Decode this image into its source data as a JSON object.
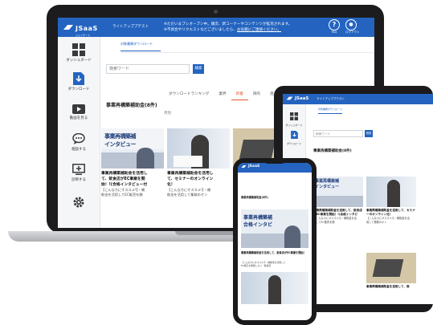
{
  "app": {
    "logo_text": "JSaaS",
    "logo_sub": "ジェイサース",
    "app_name": "ライトアッププテスト",
    "notice_line1": "※ただいまプレオープン中。順次、新コーナーやコンテンツが拡充されます。",
    "notice_line2_pre": "※不具合やリクエストなどございましたら、",
    "notice_line2_link": "お気軽にご連絡ください。",
    "faq_label": "FAQ",
    "logout_label": "ログアウト",
    "help_glyph": "?",
    "user_glyph": "●"
  },
  "sidebar": {
    "items": [
      {
        "label": "ダッシュボード",
        "icon": "grid-icon"
      },
      {
        "label": "ダウンロード",
        "icon": "download-icon"
      },
      {
        "label": "動画を見る",
        "icon": "video-icon"
      },
      {
        "label": "相談する",
        "icon": "chat-icon"
      },
      {
        "label": "診断する",
        "icon": "monitor-icon"
      },
      {
        "label": "",
        "icon": "gear-icon"
      }
    ]
  },
  "main": {
    "breadcrumb": "対象書類ダウンロード",
    "search_placeholder": "検索ワード",
    "search_button": "検索",
    "tabs": [
      "ダウンロードランキング",
      "業界",
      "新着",
      "目的",
      "週"
    ],
    "active_tab_index": 2,
    "section_title": "事業再構築補助金(8件)",
    "sort_label": "月別",
    "cards": [
      {
        "thumb_line1": "事業再構築補",
        "thumb_line2": "インタビュー",
        "title_line1": "事業再構築補助金を活用し",
        "title_line2": "て、飲食店がEC事業を開",
        "title_line3": "始！!(合格インタビュー付",
        "tag_line1": "【こんなカにオススメ!】・補",
        "tag_line2": "助金を活用してEC販売を開"
      },
      {
        "thumb_line1": "",
        "thumb_line2": "",
        "title_line1": "事業再構築補助金を活用し",
        "title_line2": "て、セミナーのオンライン",
        "title_line3": "化！",
        "tag_line1": "【こんなカにオススメ!】・補",
        "tag_line2": "助金を活用して業務のオン"
      },
      {
        "thumb_line1": "",
        "thumb_line2": "",
        "title_line1": "事",
        "title_line2": "",
        "title_line3": "",
        "tag_line1": "",
        "tag_line2": ""
      }
    ]
  },
  "tablet": {
    "breadcrumb": "対象書類ダウンロード",
    "search_placeholder": "検索ワード",
    "search_button": "検索",
    "section_title": "事業再構築補助金(8件)",
    "cards": [
      {
        "title_line1": "事業再構築補助金を活用して、飲食店",
        "title_line2": "がEC事業を開始！!(合格インタビ",
        "tag_line1": "【こんなカにオススメ!】・補助金を活",
        "tag_line2": "用してEC販売を開"
      },
      {
        "title_line1": "事業再構築補助金を活用して、セミナ",
        "title_line2": "ーのオンライン化！",
        "tag_line1": "【こんなカにオススメ!】・補助金を活",
        "tag_line2": "用して業務のオン"
      },
      {
        "title_line1": "事業再構築補助金を活用して、既",
        "title_line2": "",
        "tag_line1": "",
        "tag_line2": ""
      }
    ]
  },
  "phone": {
    "section_title": "事業再構築補助金(8件)",
    "thumb_line1": "事業再構築補",
    "thumb_line2": "合格インタビ",
    "card_title": "事業再構築補助金を活用して、飲食店がEC事業を開始！",
    "tag_line1": "【こんなカにオススメ!】・補助金を活用して",
    "tag_line2": "EC販売を開始したい・飲食店"
  },
  "colors": {
    "brand_blue": "#2464c0",
    "sidebar_bg": "#f5f6f8",
    "device_black": "#1c1c1e"
  }
}
